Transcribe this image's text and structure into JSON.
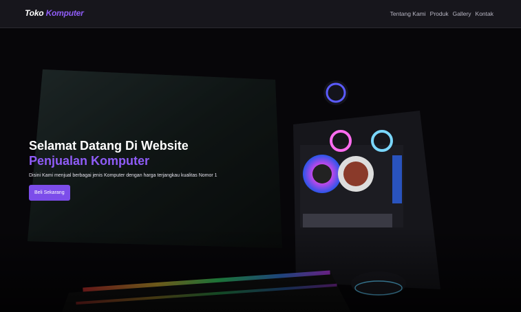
{
  "brand": {
    "part1": "Toko",
    "part2": "Komputer"
  },
  "nav": [
    "Tentang Kami",
    "Produk",
    "Gallery",
    "Kontak"
  ],
  "hero": {
    "title_line1": "Selamat Datang Di Website",
    "title_line2": "Penjualan Komputer",
    "description": "Disini Kami menjual berbagai jenis Komputer dengan harga terjangkau kualitas Nomor 1",
    "cta_label": "Beli Sekarang"
  },
  "colors": {
    "accent": "#8f5cf7",
    "button": "#7c4dea",
    "navbar": "#17161c"
  }
}
